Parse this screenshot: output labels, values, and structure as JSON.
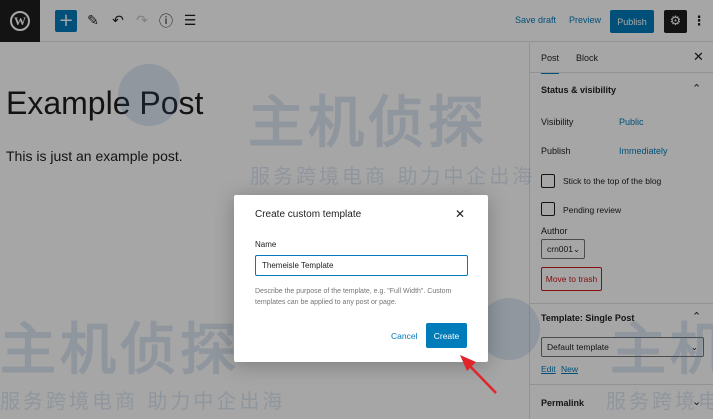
{
  "toolbar": {
    "logo_glyph": "W",
    "add_icon": "plus-icon",
    "save_draft": "Save draft",
    "preview": "Preview",
    "publish": "Publish"
  },
  "post": {
    "title": "Example Post",
    "body": "This is just an example post."
  },
  "sidebar": {
    "tabs": [
      "Post",
      "Block"
    ],
    "status_heading": "Status & visibility",
    "visibility_label": "Visibility",
    "visibility_value": "Public",
    "publish_label": "Publish",
    "publish_value": "Immediately",
    "sticky_label": "Stick to the top of the blog",
    "pending_label": "Pending review",
    "author_label": "Author",
    "author_value": "crn001",
    "trash_label": "Move to trash",
    "template_heading": "Template: Single Post",
    "template_value": "Default template",
    "edit_link": "Edit",
    "new_link": "New",
    "permalink_heading": "Permalink"
  },
  "modal": {
    "title": "Create custom template",
    "name_label": "Name",
    "name_value": "Themeisle Template",
    "help": "Describe the purpose of the template, e.g. \"Full Width\". Custom templates can be applied to any post or page.",
    "cancel": "Cancel",
    "create": "Create"
  },
  "watermark": {
    "big": "主机侦探",
    "small": "服务跨境电商 助力中企出海"
  },
  "colors": {
    "accent": "#007cba",
    "danger": "#cc1818",
    "annotation_arrow": "#e0242a"
  }
}
